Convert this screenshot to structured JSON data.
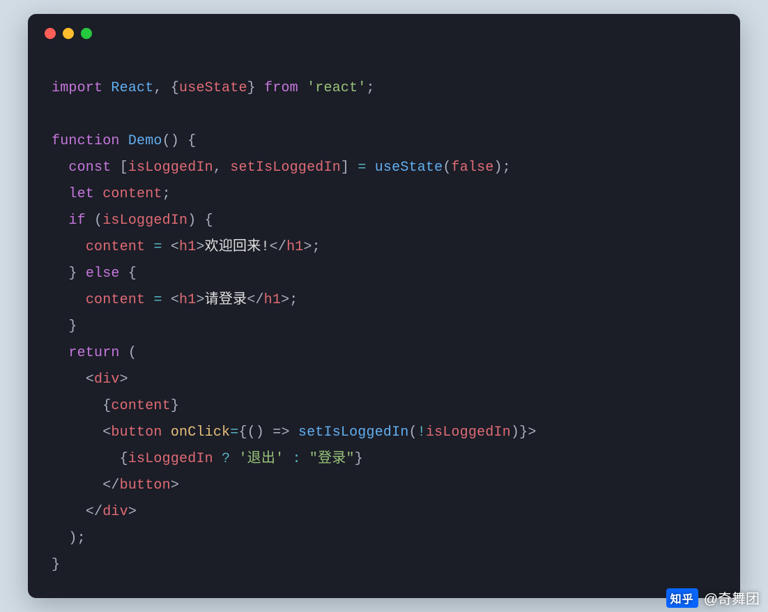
{
  "editor": {
    "traffic_lights": [
      "red",
      "yellow",
      "green"
    ]
  },
  "code": {
    "line1": {
      "import": "import",
      "react": "React",
      "lbrace": "{",
      "useState": "useState",
      "rbrace": "}",
      "from": "from",
      "str": "'react'",
      "semi": ";"
    },
    "line3": {
      "function": "function",
      "Demo": "Demo",
      "parens": "() {"
    },
    "line4": {
      "const": "const",
      "lb": "[",
      "isLoggedIn": "isLoggedIn",
      "c": ",",
      "setIsLoggedIn": "setIsLoggedIn",
      "rb": "]",
      "eq": "=",
      "useState": "useState",
      "l": "(",
      "false": "false",
      "r": ");"
    },
    "line5": {
      "let": "let",
      "content": "content",
      "semi": ";"
    },
    "line6": {
      "if": "if",
      "l": "(",
      "isLoggedIn": "isLoggedIn",
      "r": ") {"
    },
    "line7": {
      "content": "content",
      "eq": "=",
      "open": "<",
      "h1": "h1",
      "gt": ">",
      "text": "欢迎回来!",
      "close": "</",
      "h1b": "h1",
      "end": ">;"
    },
    "line8": {
      "brace": "}",
      "else": "else",
      "ob": "{"
    },
    "line9": {
      "content": "content",
      "eq": "=",
      "open": "<",
      "h1": "h1",
      "gt": ">",
      "text": "请登录",
      "close": "</",
      "h1b": "h1",
      "end": ">;"
    },
    "line10": {
      "brace": "}"
    },
    "line11": {
      "return": "return",
      "p": "("
    },
    "line12": {
      "open": "<",
      "div": "div",
      "gt": ">"
    },
    "line13": {
      "lb": "{",
      "content": "content",
      "rb": "}"
    },
    "line14": {
      "open": "<",
      "button": "button",
      "onClick": "onClick",
      "eq": "=",
      "lb": "{",
      "arrow": "() =>",
      "setIsLoggedIn": "setIsLoggedIn",
      "l": "(",
      "bang": "!",
      "isLoggedIn": "isLoggedIn",
      "r": ")",
      "rb": "}",
      "gt": ">"
    },
    "line15": {
      "lb": "{",
      "isLoggedIn": "isLoggedIn",
      "q": "?",
      "s1": "'退出'",
      "c": ":",
      "s2": "\"登录\"",
      "rb": "}"
    },
    "line16": {
      "close": "</",
      "button": "button",
      "gt": ">"
    },
    "line17": {
      "close": "</",
      "div": "div",
      "gt": ">"
    },
    "line18": {
      "p": ");"
    },
    "line19": {
      "brace": "}"
    }
  },
  "watermark": {
    "logo": "知乎",
    "author": "@奇舞团"
  }
}
